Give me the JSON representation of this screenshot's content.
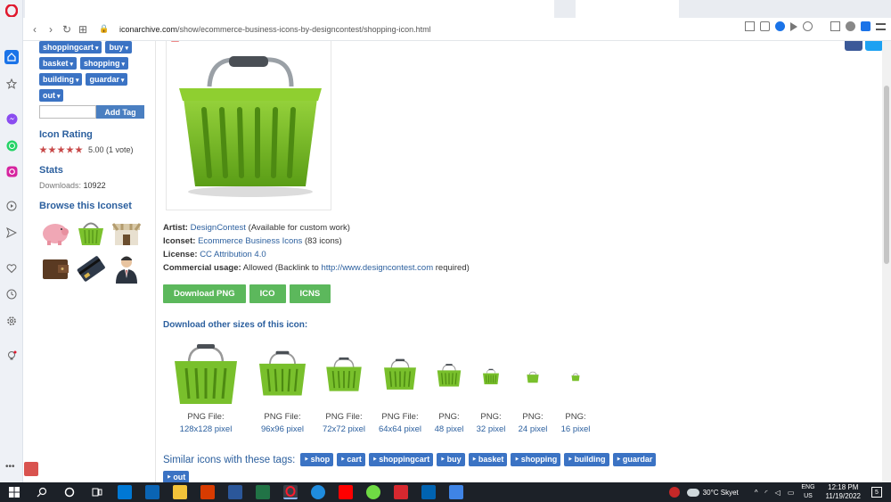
{
  "browser": {
    "url_host": "iconarchive.com",
    "url_path": "/show/ecommerce-business-icons-by-designcontest/shopping-icon.html",
    "rail_icons": [
      "opera-logo-icon",
      "home-icon",
      "star-icon",
      "messenger-icon",
      "whatsapp-icon",
      "instagram-icon",
      "play-circle-icon",
      "send-icon",
      "heart-icon",
      "history-icon",
      "settings-icon",
      "lightbulb-icon"
    ]
  },
  "sidebar": {
    "tag_rows": [
      [
        "shoppingcart",
        "buy"
      ],
      [
        "basket",
        "shopping"
      ],
      [
        "building",
        "guardar"
      ],
      [
        "out"
      ]
    ],
    "add_tag_label": "Add Tag",
    "rating_heading": "Icon Rating",
    "rating_text": "5.00 (1 vote)",
    "rating_value": 5,
    "stats_heading": "Stats",
    "downloads_label": "Downloads:",
    "downloads_value": "10922",
    "browse_heading": "Browse this Iconset",
    "iconset_thumbs": [
      "piggy-bank-icon",
      "shopping-basket-icon",
      "shop-icon",
      "wallet-icon",
      "credit-card-icon",
      "businessman-icon"
    ]
  },
  "main": {
    "artist_label": "Artist:",
    "artist_value": "DesignContest",
    "artist_note": "(Available for custom work)",
    "iconset_label": "Iconset:",
    "iconset_value": "Ecommerce Business Icons",
    "iconset_count": "(83 icons)",
    "license_label": "License:",
    "license_value": "CC Attribution 4.0",
    "commercial_label": "Commercial usage:",
    "commercial_value": "Allowed (Backlink to",
    "commercial_link": "http://www.designcontest.com",
    "commercial_tail": "required)",
    "download_buttons": [
      "Download PNG",
      "ICO",
      "ICNS"
    ],
    "other_sizes_heading": "Download other sizes of this icon:",
    "sizes": [
      {
        "label": "PNG File:",
        "px": "128x128 pixel"
      },
      {
        "label": "PNG File:",
        "px": "96x96 pixel"
      },
      {
        "label": "PNG File:",
        "px": "72x72 pixel"
      },
      {
        "label": "PNG File:",
        "px": "64x64 pixel"
      },
      {
        "label": "PNG:",
        "px": "48 pixel"
      },
      {
        "label": "PNG:",
        "px": "32 pixel"
      },
      {
        "label": "PNG:",
        "px": "24 pixel"
      },
      {
        "label": "PNG:",
        "px": "16 pixel"
      }
    ],
    "similar_label": "Similar icons with these tags:",
    "similar_tags": [
      "shop",
      "cart",
      "shoppingcart",
      "buy",
      "basket",
      "shopping",
      "building",
      "guardar",
      "out"
    ]
  },
  "taskbar": {
    "weather": "30°C Skyet",
    "lang_top": "ENG",
    "lang_bottom": "US",
    "time": "12:18 PM",
    "date": "11/19/2022",
    "notif_count": "5",
    "apps": [
      "start-icon",
      "search-icon",
      "cortana-icon",
      "taskview-icon",
      "store-icon",
      "mail-icon",
      "file-explorer-icon",
      "office-icon",
      "word-icon",
      "excel-icon",
      "opera-icon",
      "edge-icon",
      "youtube-icon",
      "upwork-icon",
      "acrobat-icon",
      "defender-icon",
      "pconnect-icon"
    ]
  },
  "colors": {
    "accent": "#2b5f9e",
    "tag_bg": "#3b73c4",
    "download_green": "#5cb85c",
    "basket_green": "#7cc22e",
    "taskbar": "#1c2128"
  }
}
